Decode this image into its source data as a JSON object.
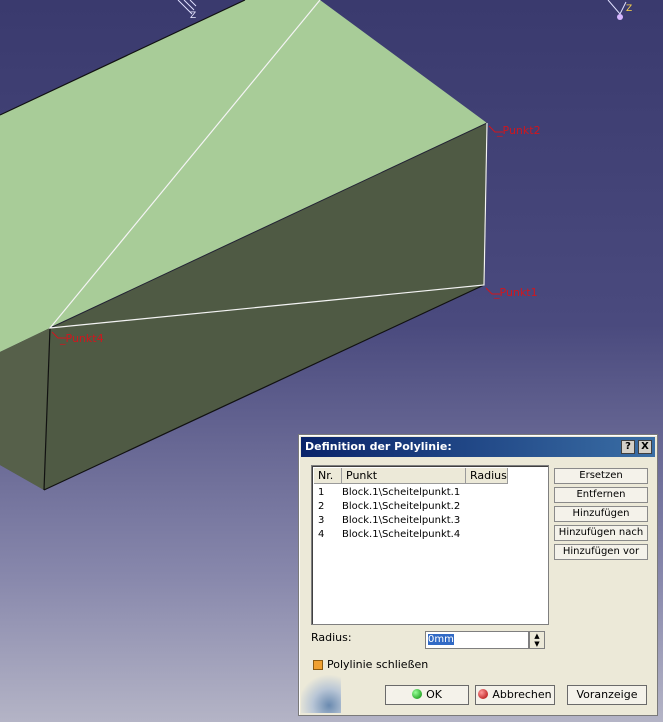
{
  "viewport": {
    "points": [
      {
        "id": "punkt2",
        "label": "Punkt2"
      },
      {
        "id": "punkt1",
        "label": "Punkt1"
      },
      {
        "id": "punkt4",
        "label": "Punkt4"
      }
    ],
    "axis_label": "Z",
    "colors": {
      "top_face": "#a8cc98",
      "side_face": "#4f5a44",
      "point_label": "#d0161e"
    }
  },
  "dialog": {
    "title": "Definition der Polylinie:",
    "help_label": "?",
    "close_label": "X",
    "columns": [
      "Nr.",
      "Punkt",
      "Radius"
    ],
    "rows": [
      {
        "nr": "1",
        "punkt": "Block.1\\Scheitelpunkt.1",
        "radius": ""
      },
      {
        "nr": "2",
        "punkt": "Block.1\\Scheitelpunkt.2",
        "radius": ""
      },
      {
        "nr": "3",
        "punkt": "Block.1\\Scheitelpunkt.3",
        "radius": ""
      },
      {
        "nr": "4",
        "punkt": "Block.1\\Scheitelpunkt.4",
        "radius": ""
      }
    ],
    "side_buttons": {
      "replace": "Ersetzen",
      "remove": "Entfernen",
      "add": "Hinzufügen",
      "add_after": "Hinzufügen nach",
      "add_before": "Hinzufügen vor"
    },
    "radius_label": "Radius:",
    "radius_value": "0mm",
    "close_polyline_label": "Polylinie schließen",
    "close_polyline_checked": true,
    "ok_label": "OK",
    "cancel_label": "Abbrechen",
    "preview_label": "Voranzeige"
  }
}
